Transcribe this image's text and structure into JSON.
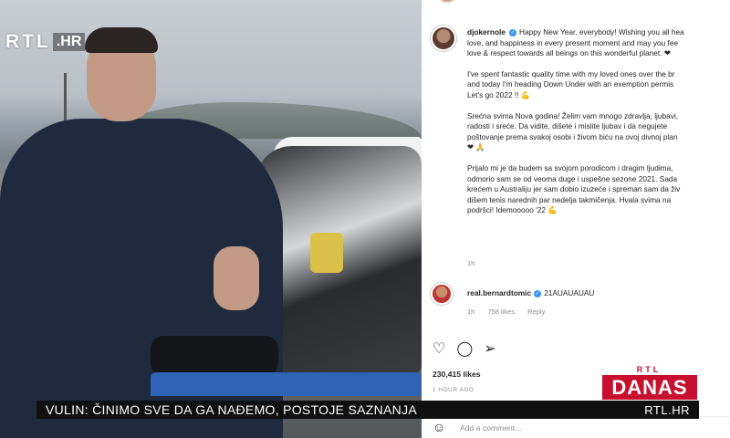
{
  "photo": {
    "logo_text": "RTL",
    "logo_suffix": ".HR"
  },
  "instagram": {
    "post": {
      "username": "djokernole",
      "caption_lines": [
        "Happy New Year, everybody! Wishing you all hea",
        "love, and happiness in every present moment and may you fee",
        "love & respect towards all beings on this wonderful planet. ❤"
      ],
      "paragraph2": [
        "I've spent fantastic quality time with my loved ones over the br",
        "and today I'm heading Down Under with an exemption permis",
        "Let's go 2022 !! 💪"
      ],
      "paragraph3": [
        "Srećna svima Nova godina! Želim vam mnogo zdravlja, ljubavi,",
        "radosti i sreće. Da vidite, dišete i mislite ljubav i da negujete",
        "poštovanje prema svakoj osobi i živom biću na ovoj divnoj plan",
        "❤ 🙏"
      ],
      "paragraph4": [
        "Prijalo mi je da budem sa svojom porodicom i dragim ljudima,",
        "odmorio sam se od veoma duge i uspešne sezone 2021. Sada",
        "krećem u Australiju jer sam dobio izuzeće i spreman sam da živ",
        "dišem tenis narednih par nedelja takmičenja. Hvala svima na",
        "podršci! Idemooooo '22 💪"
      ],
      "time": "1h"
    },
    "comment": {
      "username": "real.bernardtomic",
      "text": "21AUAUAUAU",
      "time": "1h",
      "likes": "758 likes",
      "reply": "Reply"
    },
    "actions": {
      "like_icon": "♡",
      "comment_icon": "◯",
      "share_icon": "➢"
    },
    "likes_count": "230,415 likes",
    "post_date": "1 HOUR AGO",
    "add_comment_placeholder": "Add a comment..."
  },
  "ticker": {
    "headline": "VULIN: ČINIMO SVE DA GA NAĐEMO, POSTOJE SAZNANJA",
    "site": "RTL.HR"
  },
  "danas_logo": {
    "top": "RTL",
    "main": "DANAS"
  },
  "colors": {
    "danas_red": "#c8102e",
    "verified_blue": "#3897f0"
  }
}
